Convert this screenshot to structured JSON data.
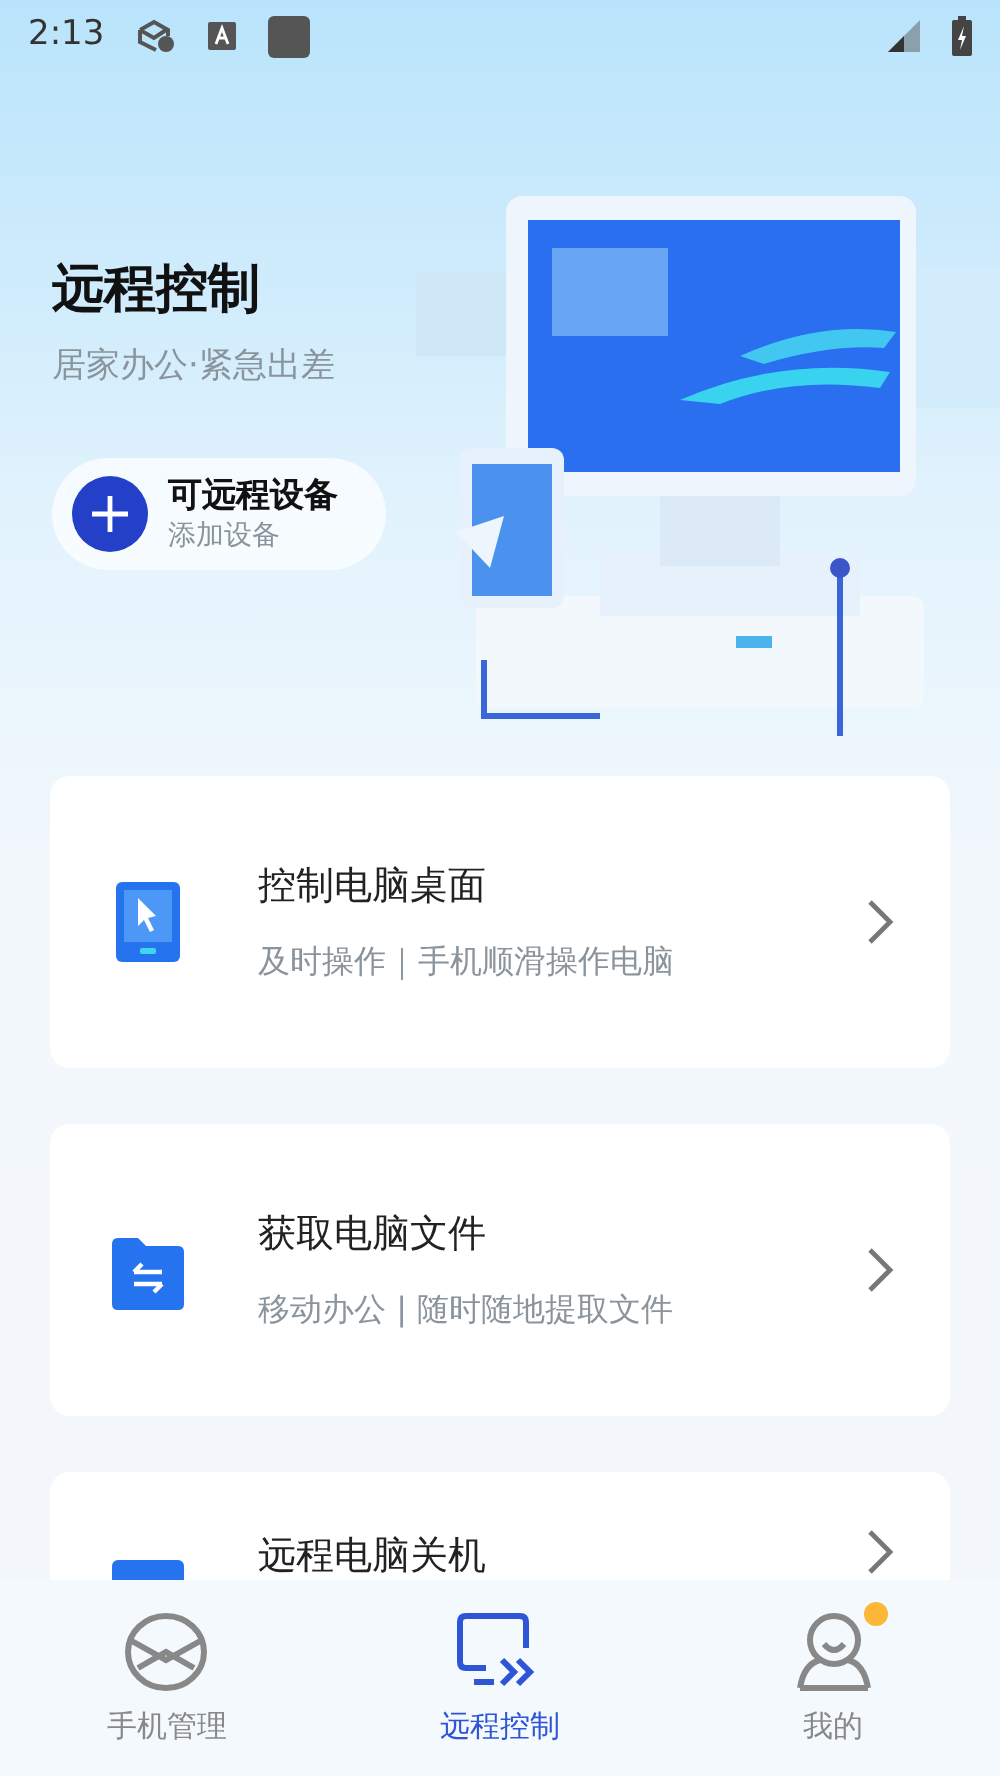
{
  "status_bar": {
    "time": "2:13"
  },
  "hero": {
    "title": "远程控制",
    "subtitle": "居家办公·紧急出差",
    "device_button": {
      "title": "可远程设备",
      "subtitle": "添加设备"
    }
  },
  "features": [
    {
      "kind": "tablet",
      "title": "控制电脑桌面",
      "subtitle": "及时操作｜手机顺滑操作电脑"
    },
    {
      "kind": "folder",
      "title": "获取电脑文件",
      "subtitle": "移动办公 | 随时随地提取文件"
    },
    {
      "kind": "power",
      "title": "远程电脑关机"
    }
  ],
  "tabs": [
    {
      "kind": "phone",
      "label": "手机管理",
      "selected": false,
      "dot": false
    },
    {
      "kind": "remote",
      "label": "远程控制",
      "selected": true,
      "dot": false
    },
    {
      "kind": "me",
      "label": "我的",
      "selected": false,
      "dot": true
    }
  ]
}
